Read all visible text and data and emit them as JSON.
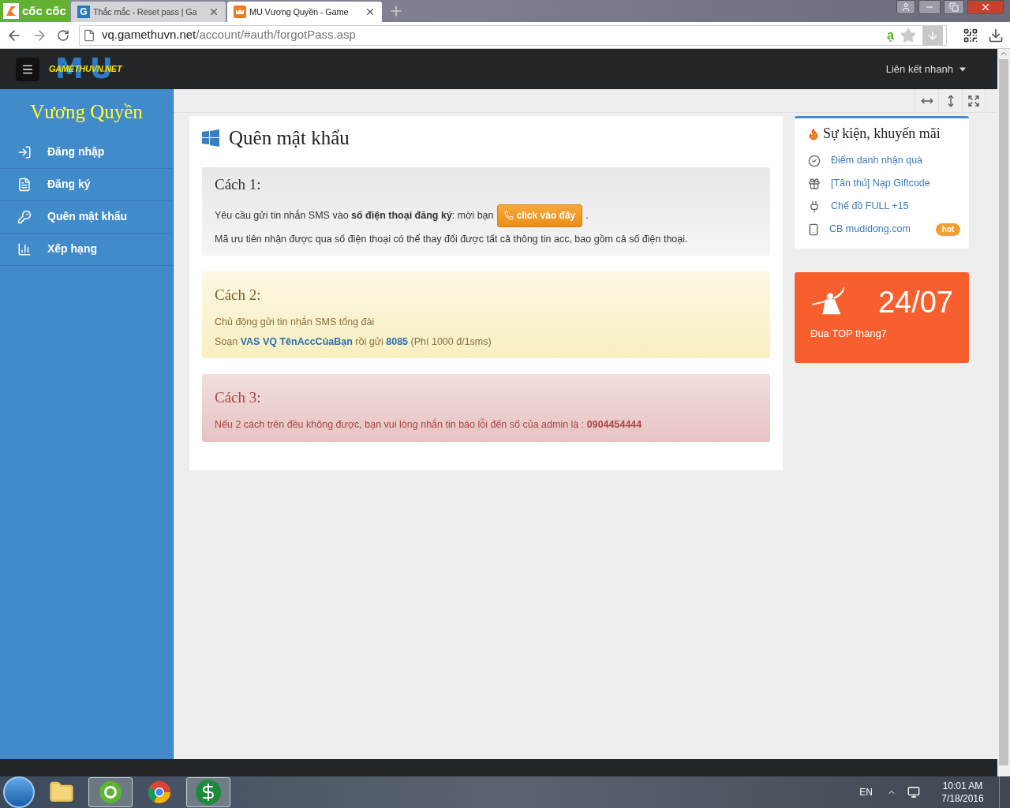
{
  "browser": {
    "brand": "cốc cốc",
    "tabs": [
      {
        "title": "Thắc mắc - Reset pass | Ga",
        "icon": "G",
        "selected": false
      },
      {
        "title": "MU Vương Quyền - Game",
        "selected": true
      }
    ],
    "address": {
      "host": "vq.gamethuvn.net",
      "path": "/account/#auth/forgotPass.asp"
    },
    "extension": "ạ"
  },
  "navbar": {
    "logo_mark": "MU",
    "logo": "GAMETHUVN.NET",
    "quick_links": "Liên kết nhanh"
  },
  "sidebar": {
    "title": "Vương Quyền",
    "items": [
      {
        "label": "Đăng nhập",
        "kind": "login"
      },
      {
        "label": "Đăng ký",
        "kind": "register"
      },
      {
        "label": "Quên mật khẩu",
        "kind": "key"
      },
      {
        "label": "Xếp hạng",
        "kind": "chart"
      }
    ]
  },
  "main": {
    "title": "Quên mật khẩu",
    "methods": [
      {
        "kind": "gray",
        "title": "Cách 1:",
        "lines": [
          "Yêu cầu gửi tin nhắn SMS vào **số điện thoại đăng ký**: mời bạn",
          "Mã ưu tiên nhận được qua số điện thoại có thể thay đổi được tất cả thông tin acc, bao gồm cả số điện thoại."
        ],
        "button": "click vào đây",
        "after_button": "."
      },
      {
        "kind": "yellow",
        "title": "Cách 2:",
        "lines": [
          "Chủ động gửi tin nhắn SMS tổng đài",
          "Soạn **VAS VQ TênAccCủaBạn** rồi gửi **8085** (Phí 1000 đ/1sms)"
        ]
      },
      {
        "kind": "red",
        "title": "Cách 3:",
        "lines": [
          "Nếu 2 cách trên đều không được, bạn vui lòng nhắn tin báo lỗi đến số của admin là : **0904454444**"
        ]
      }
    ]
  },
  "events": {
    "title": "Sự kiện, khuyến mãi",
    "items": [
      {
        "label": "Điểm danh nhận quà",
        "kind": "check"
      },
      {
        "label": "[Tân thủ] Nạp Giftcode",
        "kind": "gift"
      },
      {
        "label": "Chế đồ FULL +15",
        "kind": "plug"
      },
      {
        "label": "CB mudidong.com",
        "kind": "phone",
        "badge": "hot"
      }
    ]
  },
  "promo": {
    "date": "24/07",
    "caption": "Đua TOP tháng7"
  },
  "taskbar": {
    "apps": [
      {
        "kind": "folder",
        "selected": false
      },
      {
        "kind": "coccoc",
        "selected": true
      },
      {
        "kind": "chrome",
        "selected": false
      },
      {
        "kind": "dollar",
        "selected": true
      }
    ],
    "language": "EN",
    "time": "10:01 AM",
    "date": "7/18/2016"
  }
}
